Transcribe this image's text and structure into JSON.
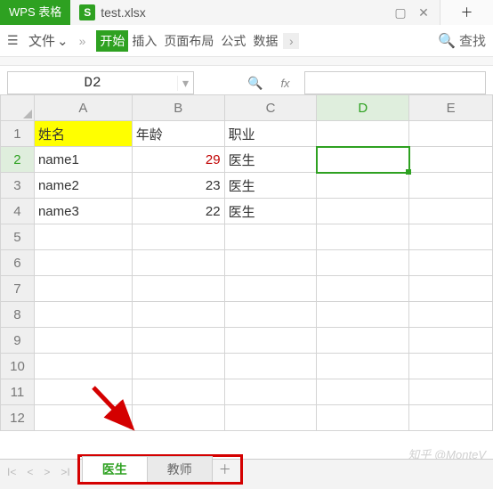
{
  "title_bar": {
    "app_name": "WPS 表格",
    "file_badge": "S",
    "file_name": "test.xlsx",
    "minimize_icon": "▢",
    "close_icon": "✕",
    "new_tab_icon": "＋"
  },
  "ribbon": {
    "file_label": "文件",
    "file_dropdown": "⌄",
    "more_glyph": "»",
    "tabs": {
      "start": "开始",
      "insert": "插入",
      "page_layout": "页面布局",
      "formulas": "公式",
      "data": "数据"
    },
    "overflow_glyph": "›",
    "search_label": "查找"
  },
  "formula_bar": {
    "cell_ref": "D2",
    "fx_label": "fx",
    "formula_value": ""
  },
  "columns": [
    "A",
    "B",
    "C",
    "D",
    "E"
  ],
  "active_col_index": 3,
  "active_row_index": 1,
  "row_count": 12,
  "header_row": {
    "a": "姓名",
    "b": "年龄",
    "c": "职业"
  },
  "data_rows": [
    {
      "a": "name1",
      "b": "29",
      "c": "医生",
      "b_red": true
    },
    {
      "a": "name2",
      "b": "23",
      "c": "医生",
      "b_red": false
    },
    {
      "a": "name3",
      "b": "22",
      "c": "医生",
      "b_red": false
    }
  ],
  "sheet_tabs": {
    "active": "医生",
    "other": "教师",
    "add_glyph": "＋"
  },
  "nav_glyphs": {
    "first": "I<",
    "prev": "<",
    "next": ">",
    "last": ">I"
  },
  "watermark": "知乎 @MonteV"
}
